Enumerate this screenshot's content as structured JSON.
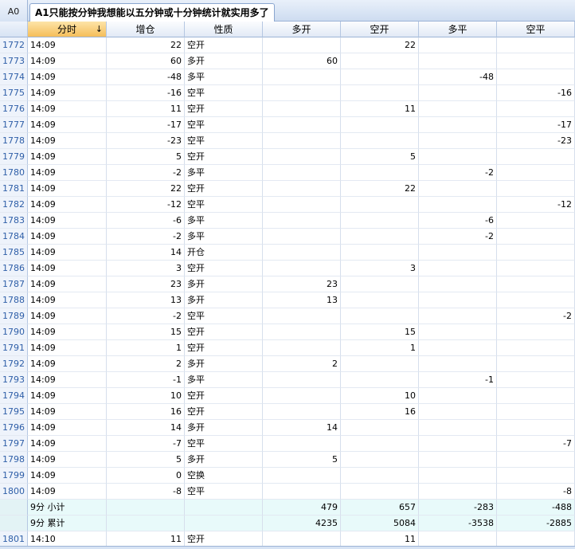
{
  "topbar": {
    "cell_ref": "A0",
    "tab_title": "A1只能按分钟我想能以五分钟或十分钟统计就实用多了"
  },
  "columns": [
    {
      "key": "rn",
      "label": ""
    },
    {
      "key": "time",
      "label": "分时",
      "sort": "↓"
    },
    {
      "key": "delta",
      "label": "增仓"
    },
    {
      "key": "nature",
      "label": "性质"
    },
    {
      "key": "long_open",
      "label": "多开"
    },
    {
      "key": "short_open",
      "label": "空开"
    },
    {
      "key": "long_close",
      "label": "多平"
    },
    {
      "key": "short_close",
      "label": "空平"
    }
  ],
  "rows": [
    {
      "rn": "1772",
      "time": "14:09",
      "delta": "22",
      "nature": "空开",
      "long_open": "",
      "short_open": "22",
      "long_close": "",
      "short_close": ""
    },
    {
      "rn": "1773",
      "time": "14:09",
      "delta": "60",
      "nature": "多开",
      "long_open": "60",
      "short_open": "",
      "long_close": "",
      "short_close": ""
    },
    {
      "rn": "1774",
      "time": "14:09",
      "delta": "-48",
      "nature": "多平",
      "long_open": "",
      "short_open": "",
      "long_close": "-48",
      "short_close": ""
    },
    {
      "rn": "1775",
      "time": "14:09",
      "delta": "-16",
      "nature": "空平",
      "long_open": "",
      "short_open": "",
      "long_close": "",
      "short_close": "-16"
    },
    {
      "rn": "1776",
      "time": "14:09",
      "delta": "11",
      "nature": "空开",
      "long_open": "",
      "short_open": "11",
      "long_close": "",
      "short_close": ""
    },
    {
      "rn": "1777",
      "time": "14:09",
      "delta": "-17",
      "nature": "空平",
      "long_open": "",
      "short_open": "",
      "long_close": "",
      "short_close": "-17"
    },
    {
      "rn": "1778",
      "time": "14:09",
      "delta": "-23",
      "nature": "空平",
      "long_open": "",
      "short_open": "",
      "long_close": "",
      "short_close": "-23"
    },
    {
      "rn": "1779",
      "time": "14:09",
      "delta": "5",
      "nature": "空开",
      "long_open": "",
      "short_open": "5",
      "long_close": "",
      "short_close": ""
    },
    {
      "rn": "1780",
      "time": "14:09",
      "delta": "-2",
      "nature": "多平",
      "long_open": "",
      "short_open": "",
      "long_close": "-2",
      "short_close": ""
    },
    {
      "rn": "1781",
      "time": "14:09",
      "delta": "22",
      "nature": "空开",
      "long_open": "",
      "short_open": "22",
      "long_close": "",
      "short_close": ""
    },
    {
      "rn": "1782",
      "time": "14:09",
      "delta": "-12",
      "nature": "空平",
      "long_open": "",
      "short_open": "",
      "long_close": "",
      "short_close": "-12"
    },
    {
      "rn": "1783",
      "time": "14:09",
      "delta": "-6",
      "nature": "多平",
      "long_open": "",
      "short_open": "",
      "long_close": "-6",
      "short_close": ""
    },
    {
      "rn": "1784",
      "time": "14:09",
      "delta": "-2",
      "nature": "多平",
      "long_open": "",
      "short_open": "",
      "long_close": "-2",
      "short_close": ""
    },
    {
      "rn": "1785",
      "time": "14:09",
      "delta": "14",
      "nature": "开仓",
      "long_open": "",
      "short_open": "",
      "long_close": "",
      "short_close": ""
    },
    {
      "rn": "1786",
      "time": "14:09",
      "delta": "3",
      "nature": "空开",
      "long_open": "",
      "short_open": "3",
      "long_close": "",
      "short_close": ""
    },
    {
      "rn": "1787",
      "time": "14:09",
      "delta": "23",
      "nature": "多开",
      "long_open": "23",
      "short_open": "",
      "long_close": "",
      "short_close": ""
    },
    {
      "rn": "1788",
      "time": "14:09",
      "delta": "13",
      "nature": "多开",
      "long_open": "13",
      "short_open": "",
      "long_close": "",
      "short_close": ""
    },
    {
      "rn": "1789",
      "time": "14:09",
      "delta": "-2",
      "nature": "空平",
      "long_open": "",
      "short_open": "",
      "long_close": "",
      "short_close": "-2"
    },
    {
      "rn": "1790",
      "time": "14:09",
      "delta": "15",
      "nature": "空开",
      "long_open": "",
      "short_open": "15",
      "long_close": "",
      "short_close": ""
    },
    {
      "rn": "1791",
      "time": "14:09",
      "delta": "1",
      "nature": "空开",
      "long_open": "",
      "short_open": "1",
      "long_close": "",
      "short_close": ""
    },
    {
      "rn": "1792",
      "time": "14:09",
      "delta": "2",
      "nature": "多开",
      "long_open": "2",
      "short_open": "",
      "long_close": "",
      "short_close": ""
    },
    {
      "rn": "1793",
      "time": "14:09",
      "delta": "-1",
      "nature": "多平",
      "long_open": "",
      "short_open": "",
      "long_close": "-1",
      "short_close": ""
    },
    {
      "rn": "1794",
      "time": "14:09",
      "delta": "10",
      "nature": "空开",
      "long_open": "",
      "short_open": "10",
      "long_close": "",
      "short_close": ""
    },
    {
      "rn": "1795",
      "time": "14:09",
      "delta": "16",
      "nature": "空开",
      "long_open": "",
      "short_open": "16",
      "long_close": "",
      "short_close": ""
    },
    {
      "rn": "1796",
      "time": "14:09",
      "delta": "14",
      "nature": "多开",
      "long_open": "14",
      "short_open": "",
      "long_close": "",
      "short_close": ""
    },
    {
      "rn": "1797",
      "time": "14:09",
      "delta": "-7",
      "nature": "空平",
      "long_open": "",
      "short_open": "",
      "long_close": "",
      "short_close": "-7"
    },
    {
      "rn": "1798",
      "time": "14:09",
      "delta": "5",
      "nature": "多开",
      "long_open": "5",
      "short_open": "",
      "long_close": "",
      "short_close": ""
    },
    {
      "rn": "1799",
      "time": "14:09",
      "delta": "0",
      "nature": "空换",
      "long_open": "",
      "short_open": "",
      "long_close": "",
      "short_close": ""
    },
    {
      "rn": "1800",
      "time": "14:09",
      "delta": "-8",
      "nature": "空平",
      "long_open": "",
      "short_open": "",
      "long_close": "",
      "short_close": "-8"
    },
    {
      "rn": "",
      "time": "9分 小计",
      "delta": "",
      "nature": "",
      "long_open": "479",
      "short_open": "657",
      "long_close": "-283",
      "short_close": "-488",
      "summary": true
    },
    {
      "rn": "",
      "time": "9分 累计",
      "delta": "",
      "nature": "",
      "long_open": "4235",
      "short_open": "5084",
      "long_close": "-3538",
      "short_close": "-2885",
      "summary": true
    },
    {
      "rn": "1801",
      "time": "14:10",
      "delta": "11",
      "nature": "空开",
      "long_open": "",
      "short_open": "11",
      "long_close": "",
      "short_close": ""
    }
  ]
}
